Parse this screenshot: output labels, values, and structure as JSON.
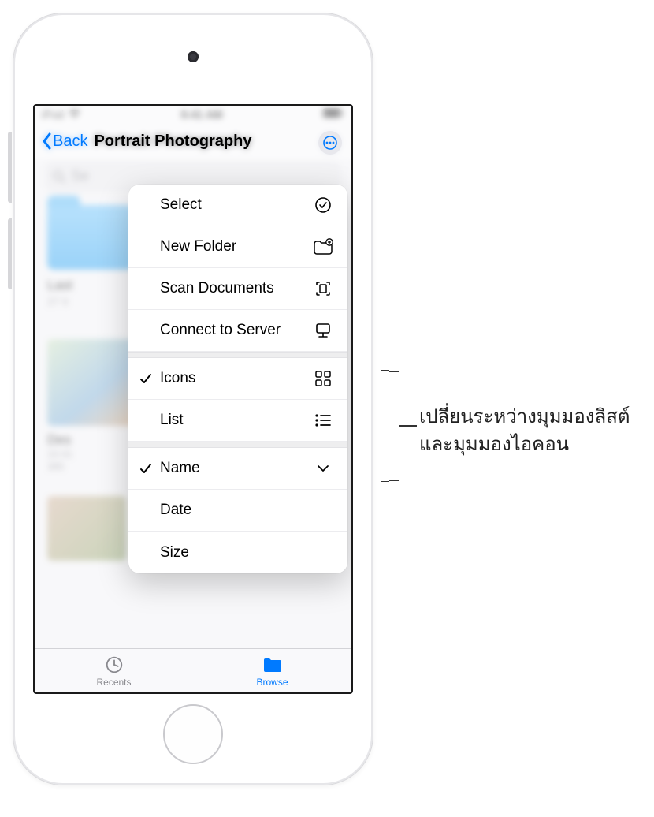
{
  "status_bar": {
    "carrier": "iPod",
    "time": "9:41 AM"
  },
  "nav": {
    "back_label": "Back",
    "title": "Portrait Photography"
  },
  "search": {
    "placeholder_visible": "Se"
  },
  "background_items": {
    "folder": {
      "name_visible": "Last",
      "sub_visible": "27 it"
    },
    "thumb": {
      "name_visible": "Des",
      "line1": "10:41",
      "line2": "385"
    }
  },
  "menu": {
    "actions": {
      "select": "Select",
      "new_folder": "New Folder",
      "scan_documents": "Scan Documents",
      "connect_server": "Connect to Server"
    },
    "view": {
      "icons": "Icons",
      "list": "List",
      "selected": "icons"
    },
    "sort": {
      "name": "Name",
      "date": "Date",
      "size": "Size",
      "selected": "name"
    }
  },
  "tabs": {
    "recents": "Recents",
    "browse": "Browse",
    "active": "browse"
  },
  "callout": {
    "line1": "เปลี่ยนระหว่างมุมมองลิสต์",
    "line2": "และมุมมองไอคอน"
  }
}
